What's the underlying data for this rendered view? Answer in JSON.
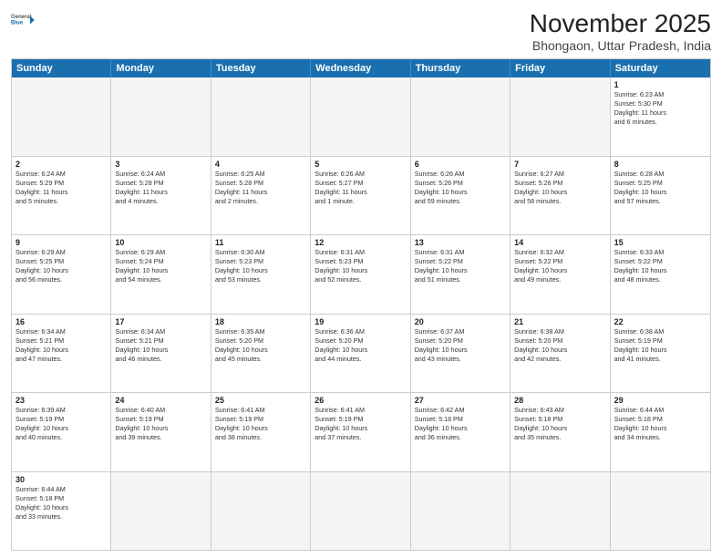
{
  "header": {
    "logo_general": "General",
    "logo_blue": "Blue",
    "month": "November 2025",
    "location": "Bhongaon, Uttar Pradesh, India"
  },
  "weekdays": [
    "Sunday",
    "Monday",
    "Tuesday",
    "Wednesday",
    "Thursday",
    "Friday",
    "Saturday"
  ],
  "rows": [
    [
      {
        "day": "",
        "text": ""
      },
      {
        "day": "",
        "text": ""
      },
      {
        "day": "",
        "text": ""
      },
      {
        "day": "",
        "text": ""
      },
      {
        "day": "",
        "text": ""
      },
      {
        "day": "",
        "text": ""
      },
      {
        "day": "1",
        "text": "Sunrise: 6:23 AM\nSunset: 5:30 PM\nDaylight: 11 hours\nand 6 minutes."
      }
    ],
    [
      {
        "day": "2",
        "text": "Sunrise: 6:24 AM\nSunset: 5:29 PM\nDaylight: 11 hours\nand 5 minutes."
      },
      {
        "day": "3",
        "text": "Sunrise: 6:24 AM\nSunset: 5:28 PM\nDaylight: 11 hours\nand 4 minutes."
      },
      {
        "day": "4",
        "text": "Sunrise: 6:25 AM\nSunset: 5:28 PM\nDaylight: 11 hours\nand 2 minutes."
      },
      {
        "day": "5",
        "text": "Sunrise: 6:26 AM\nSunset: 5:27 PM\nDaylight: 11 hours\nand 1 minute."
      },
      {
        "day": "6",
        "text": "Sunrise: 6:26 AM\nSunset: 5:26 PM\nDaylight: 10 hours\nand 59 minutes."
      },
      {
        "day": "7",
        "text": "Sunrise: 6:27 AM\nSunset: 5:26 PM\nDaylight: 10 hours\nand 58 minutes."
      },
      {
        "day": "8",
        "text": "Sunrise: 6:28 AM\nSunset: 5:25 PM\nDaylight: 10 hours\nand 57 minutes."
      }
    ],
    [
      {
        "day": "9",
        "text": "Sunrise: 6:29 AM\nSunset: 5:25 PM\nDaylight: 10 hours\nand 56 minutes."
      },
      {
        "day": "10",
        "text": "Sunrise: 6:29 AM\nSunset: 5:24 PM\nDaylight: 10 hours\nand 54 minutes."
      },
      {
        "day": "11",
        "text": "Sunrise: 6:30 AM\nSunset: 5:23 PM\nDaylight: 10 hours\nand 53 minutes."
      },
      {
        "day": "12",
        "text": "Sunrise: 6:31 AM\nSunset: 5:23 PM\nDaylight: 10 hours\nand 52 minutes."
      },
      {
        "day": "13",
        "text": "Sunrise: 6:31 AM\nSunset: 5:22 PM\nDaylight: 10 hours\nand 51 minutes."
      },
      {
        "day": "14",
        "text": "Sunrise: 6:32 AM\nSunset: 5:22 PM\nDaylight: 10 hours\nand 49 minutes."
      },
      {
        "day": "15",
        "text": "Sunrise: 6:33 AM\nSunset: 5:22 PM\nDaylight: 10 hours\nand 48 minutes."
      }
    ],
    [
      {
        "day": "16",
        "text": "Sunrise: 6:34 AM\nSunset: 5:21 PM\nDaylight: 10 hours\nand 47 minutes."
      },
      {
        "day": "17",
        "text": "Sunrise: 6:34 AM\nSunset: 5:21 PM\nDaylight: 10 hours\nand 46 minutes."
      },
      {
        "day": "18",
        "text": "Sunrise: 6:35 AM\nSunset: 5:20 PM\nDaylight: 10 hours\nand 45 minutes."
      },
      {
        "day": "19",
        "text": "Sunrise: 6:36 AM\nSunset: 5:20 PM\nDaylight: 10 hours\nand 44 minutes."
      },
      {
        "day": "20",
        "text": "Sunrise: 6:37 AM\nSunset: 5:20 PM\nDaylight: 10 hours\nand 43 minutes."
      },
      {
        "day": "21",
        "text": "Sunrise: 6:38 AM\nSunset: 5:20 PM\nDaylight: 10 hours\nand 42 minutes."
      },
      {
        "day": "22",
        "text": "Sunrise: 6:38 AM\nSunset: 5:19 PM\nDaylight: 10 hours\nand 41 minutes."
      }
    ],
    [
      {
        "day": "23",
        "text": "Sunrise: 6:39 AM\nSunset: 5:19 PM\nDaylight: 10 hours\nand 40 minutes."
      },
      {
        "day": "24",
        "text": "Sunrise: 6:40 AM\nSunset: 5:19 PM\nDaylight: 10 hours\nand 39 minutes."
      },
      {
        "day": "25",
        "text": "Sunrise: 6:41 AM\nSunset: 5:19 PM\nDaylight: 10 hours\nand 38 minutes."
      },
      {
        "day": "26",
        "text": "Sunrise: 6:41 AM\nSunset: 5:19 PM\nDaylight: 10 hours\nand 37 minutes."
      },
      {
        "day": "27",
        "text": "Sunrise: 6:42 AM\nSunset: 5:18 PM\nDaylight: 10 hours\nand 36 minutes."
      },
      {
        "day": "28",
        "text": "Sunrise: 6:43 AM\nSunset: 5:18 PM\nDaylight: 10 hours\nand 35 minutes."
      },
      {
        "day": "29",
        "text": "Sunrise: 6:44 AM\nSunset: 5:18 PM\nDaylight: 10 hours\nand 34 minutes."
      }
    ],
    [
      {
        "day": "30",
        "text": "Sunrise: 6:44 AM\nSunset: 5:18 PM\nDaylight: 10 hours\nand 33 minutes."
      },
      {
        "day": "",
        "text": ""
      },
      {
        "day": "",
        "text": ""
      },
      {
        "day": "",
        "text": ""
      },
      {
        "day": "",
        "text": ""
      },
      {
        "day": "",
        "text": ""
      },
      {
        "day": "",
        "text": ""
      }
    ]
  ]
}
